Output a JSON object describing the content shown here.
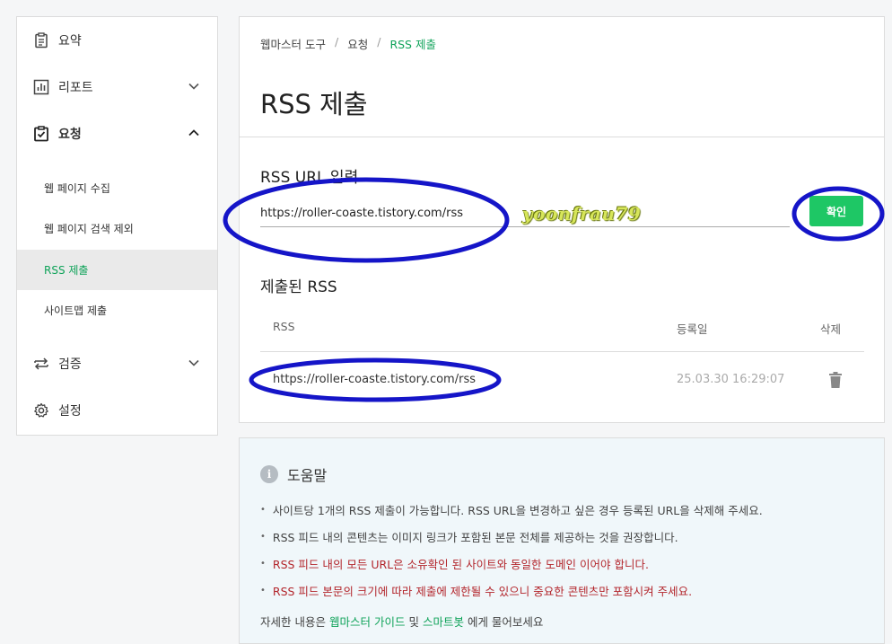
{
  "sidebar": {
    "items": [
      {
        "label": "요약",
        "icon": "clipboard-list-icon"
      },
      {
        "label": "리포트",
        "icon": "bar-chart-icon"
      },
      {
        "label": "요청",
        "icon": "clipboard-check-icon"
      },
      {
        "label": "검증",
        "icon": "swap-arrows-icon"
      },
      {
        "label": "설정",
        "icon": "gear-icon"
      }
    ],
    "sub_items": [
      {
        "label": "웹 페이지 수집"
      },
      {
        "label": "웹 페이지 검색 제외"
      },
      {
        "label": "RSS 제출"
      },
      {
        "label": "사이트맵 제출"
      }
    ]
  },
  "breadcrumb": {
    "items": [
      "웹마스터 도구",
      "요청",
      "RSS 제출"
    ],
    "sep": "/"
  },
  "main": {
    "title": "RSS 제출",
    "input_section": {
      "title": "RSS URL 입력",
      "value": "https://roller-coaste.tistory.com/rss",
      "button": "확인"
    },
    "watermark": "yoonfrau79",
    "submitted_section": {
      "title": "제출된 RSS",
      "columns": [
        "RSS",
        "등록일",
        "삭제"
      ],
      "rows": [
        {
          "url": "https://roller-coaste.tistory.com/rss",
          "date": "25.03.30 16:29:07"
        }
      ]
    }
  },
  "help": {
    "title": "도움말",
    "items": [
      {
        "text": "사이트당 1개의 RSS 제출이 가능합니다. RSS URL을 변경하고 싶은 경우 등록된 URL을 삭제해 주세요.",
        "warn": false
      },
      {
        "text": "RSS 피드 내의 콘텐츠는 이미지 링크가 포함된 본문 전체를 제공하는 것을 권장합니다.",
        "warn": false
      },
      {
        "text": "RSS 피드 내의 모든 URL은 소유확인 된 사이트와 동일한 도메인 이어야 합니다.",
        "warn": true
      },
      {
        "text": "RSS 피드 본문의 크기에 따라 제출에 제한될 수 있으니 중요한 콘텐츠만 포함시켜 주세요.",
        "warn": true
      }
    ],
    "footer": {
      "prefix": "자세한 내용은",
      "link1": "웹마스터 가이드",
      "mid": "및",
      "link2": "스마트봇",
      "suffix": "에게 물어보세요"
    }
  },
  "colors": {
    "accent": "#10a35a",
    "button": "#1ec765",
    "warn": "#b3262c",
    "annotation": "#1515c8"
  }
}
